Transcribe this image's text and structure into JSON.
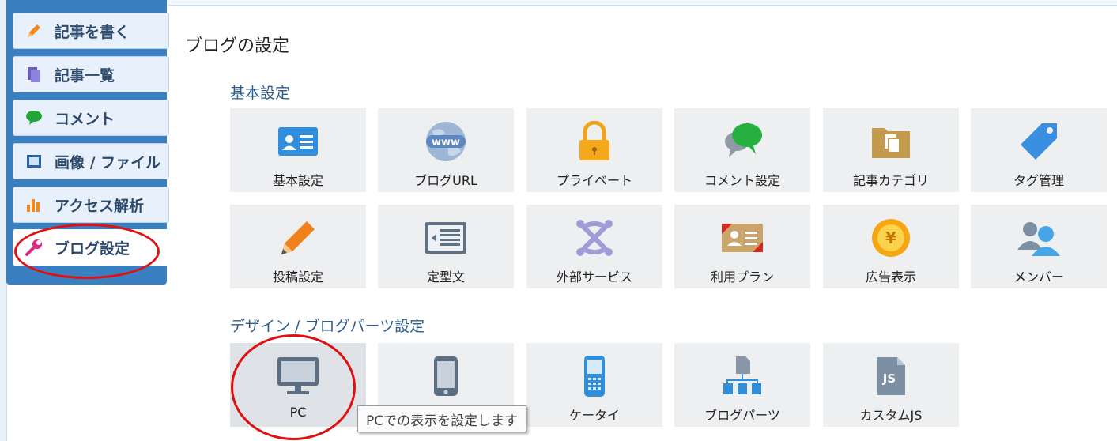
{
  "sidebar": {
    "items": [
      {
        "label": "記事を書く",
        "icon": "pencil-icon"
      },
      {
        "label": "記事一覧",
        "icon": "document-icon"
      },
      {
        "label": "コメント",
        "icon": "speech-bubble-icon"
      },
      {
        "label": "画像 / ファイル",
        "icon": "image-frame-icon"
      },
      {
        "label": "アクセス解析",
        "icon": "bar-chart-icon"
      },
      {
        "label": "ブログ設定",
        "icon": "wrench-icon"
      }
    ]
  },
  "page": {
    "title": "ブログの設定"
  },
  "sections": {
    "basic": {
      "heading": "基本設定",
      "tiles": [
        {
          "label": "基本設定",
          "icon": "id-card-icon"
        },
        {
          "label": "ブログURL",
          "icon": "www-globe-icon"
        },
        {
          "label": "プライベート",
          "icon": "padlock-icon"
        },
        {
          "label": "コメント設定",
          "icon": "speech-bubbles-icon"
        },
        {
          "label": "記事カテゴリ",
          "icon": "folder-documents-icon"
        },
        {
          "label": "タグ管理",
          "icon": "tag-icon"
        },
        {
          "label": "投稿設定",
          "icon": "pencil-icon"
        },
        {
          "label": "定型文",
          "icon": "template-text-icon"
        },
        {
          "label": "外部サービス",
          "icon": "joomla-services-icon"
        },
        {
          "label": "利用プラン",
          "icon": "plan-card-icon"
        },
        {
          "label": "広告表示",
          "icon": "yen-coin-icon"
        },
        {
          "label": "メンバー",
          "icon": "members-icon"
        }
      ]
    },
    "design": {
      "heading": "デザイン / ブログパーツ設定",
      "tiles": [
        {
          "label": "PC",
          "icon": "monitor-icon"
        },
        {
          "label": "",
          "icon": "smartphone-icon"
        },
        {
          "label": "ケータイ",
          "icon": "feature-phone-icon"
        },
        {
          "label": "ブログパーツ",
          "icon": "blog-parts-icon"
        },
        {
          "label": "カスタムJS",
          "icon": "js-file-icon"
        }
      ]
    }
  },
  "tooltip": {
    "text": "PCでの表示を設定します"
  },
  "colors": {
    "sidebar_bg": "#3a7fc0",
    "highlight_oval": "#e01010",
    "heading": "#2e5c8a",
    "tile_bg": "#eeeff1"
  }
}
